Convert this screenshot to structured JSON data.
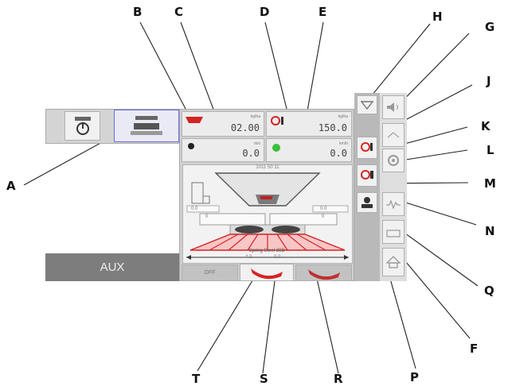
{
  "top_buttons": {
    "power_icon": "power-icon",
    "spreader_icon": "spreader-icon"
  },
  "aux_label": "AUX",
  "top_left": {
    "unit": "kg/ha",
    "value": "02.00"
  },
  "top_right": {
    "unit": "kg/ha",
    "value": "150.0"
  },
  "mid_left": {
    "unit": "m/s",
    "value": "0.0"
  },
  "mid_right": {
    "unit": "km/h",
    "value": "0.0"
  },
  "center": {
    "top_label": "1011  50   11",
    "left_readout": "0.0",
    "right_readout": "0.0",
    "box_left": "0",
    "box_right": "0",
    "spread_caption": "Spring Steel  30B",
    "scale_left": "4.0",
    "scale_right": "0.0"
  },
  "bottom_tabs": {
    "left_label": "OFF"
  },
  "callouts": [
    "A",
    "B",
    "C",
    "D",
    "E",
    "F",
    "G",
    "H",
    "J",
    "K",
    "L",
    "M",
    "N",
    "P",
    "Q",
    "R",
    "S",
    "T"
  ],
  "colors": {
    "accent_red": "#d42424",
    "panel_grey": "#d4d4d4",
    "cell_bg": "#ececec"
  }
}
